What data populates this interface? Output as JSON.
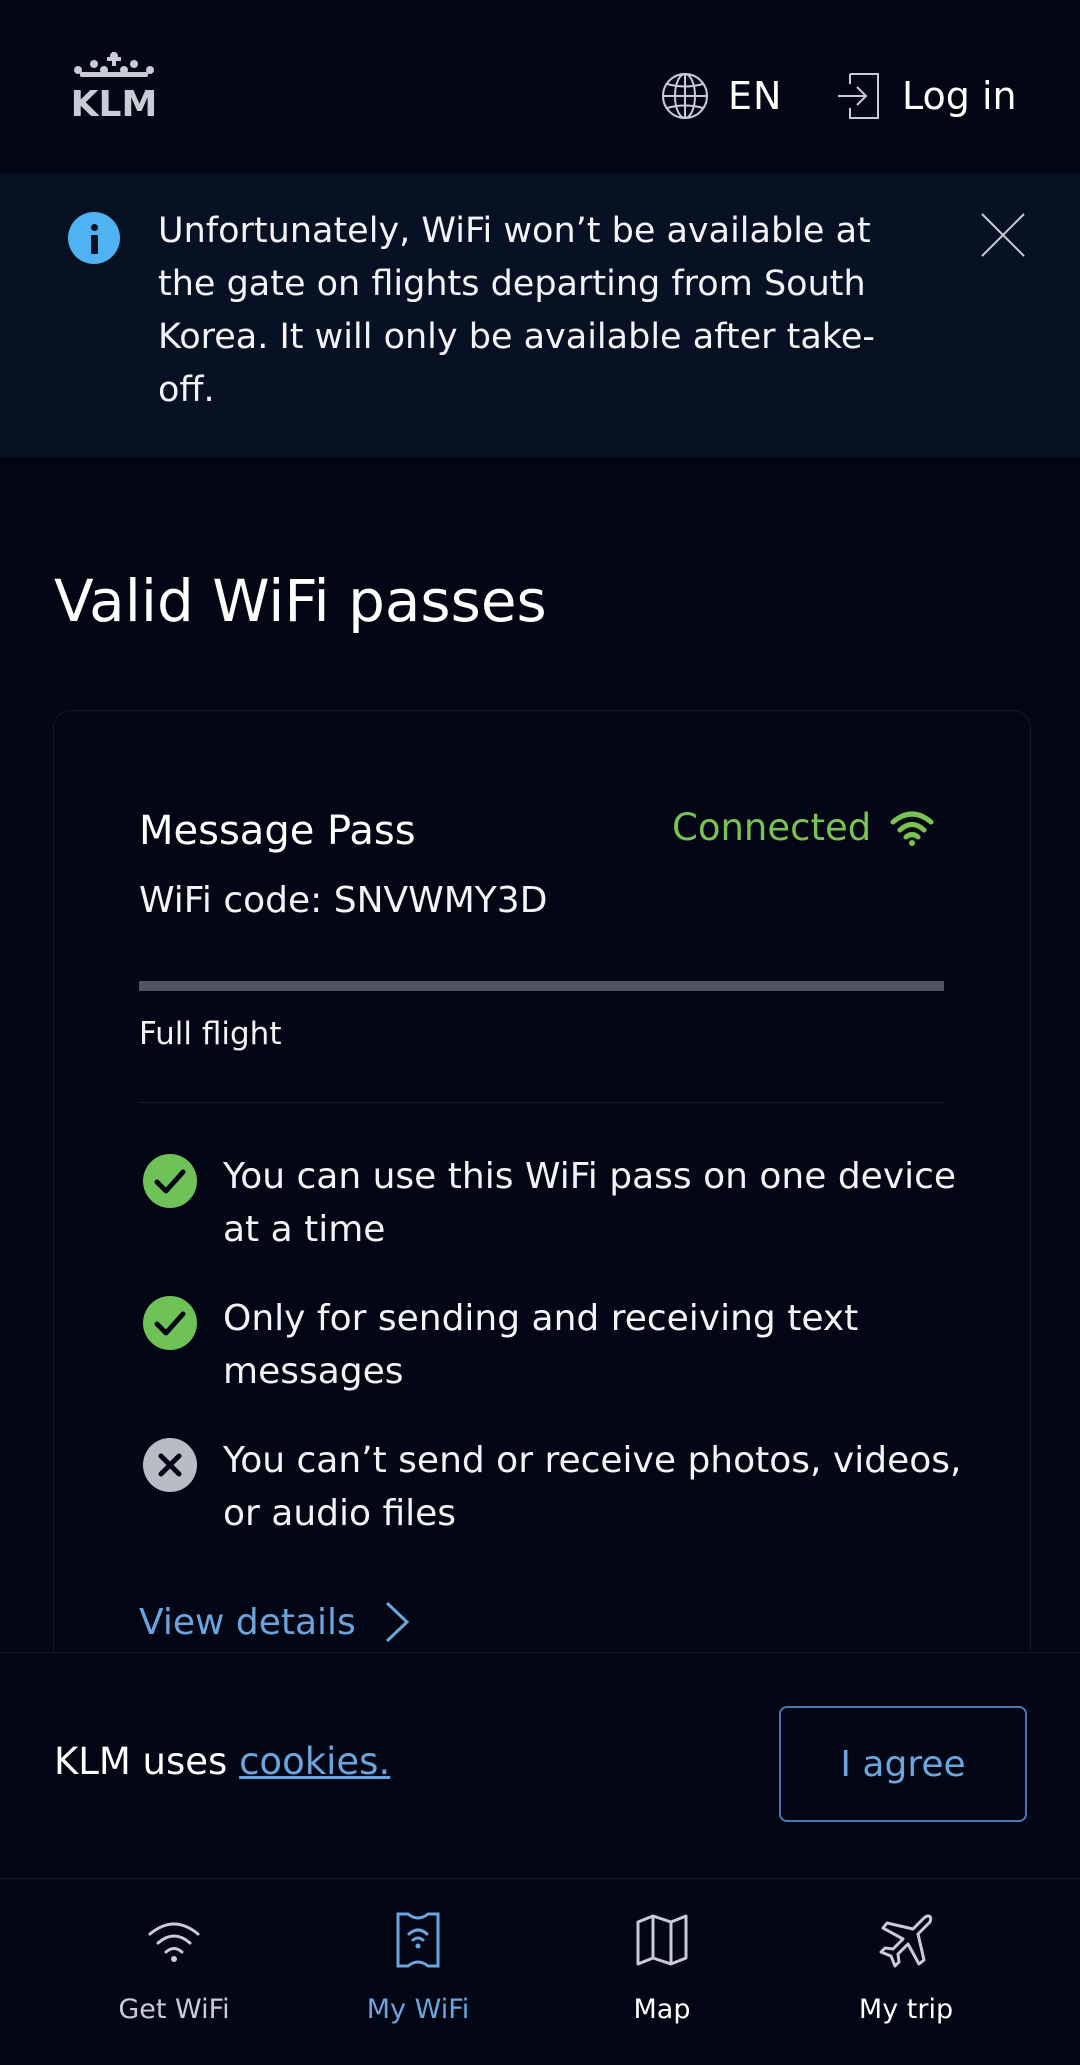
{
  "header": {
    "logo_text": "KLM",
    "language": "EN",
    "login_label": "Log in"
  },
  "notice": {
    "text": "Unfortunately, WiFi won’t be available at the gate on flights departing from South Korea. It will only be available after take-off."
  },
  "section": {
    "title": "Valid WiFi passes"
  },
  "pass": {
    "name": "Message Pass",
    "status": "Connected",
    "wifi_code": "WiFi code: SNVWMY3D",
    "progress_fraction": 1.0,
    "duration": "Full flight",
    "features": [
      {
        "allowed": true,
        "text": "You can use this WiFi pass on one device at a time"
      },
      {
        "allowed": true,
        "text": "Only for sending and receiving text messages"
      },
      {
        "allowed": false,
        "text": "You can’t send or receive photos, videos, or audio files"
      }
    ],
    "view_details": "View details"
  },
  "cookie": {
    "prefix": "KLM uses ",
    "link": "cookies.",
    "agree": "I agree"
  },
  "nav": {
    "items": [
      {
        "label": "Get WiFi",
        "icon": "wifi-icon",
        "active": false
      },
      {
        "label": "My WiFi",
        "icon": "ticket-icon",
        "active": true
      },
      {
        "label": "Map",
        "icon": "map-icon",
        "active": false
      },
      {
        "label": "My trip",
        "icon": "plane-icon",
        "active": false
      }
    ]
  },
  "colors": {
    "background": "#030614",
    "notice_bg": "#061224",
    "connected": "#79c353",
    "link": "#6aa6dd",
    "check": "#6fc258",
    "cross": "#b9bcc4",
    "info": "#4fb3f3"
  }
}
